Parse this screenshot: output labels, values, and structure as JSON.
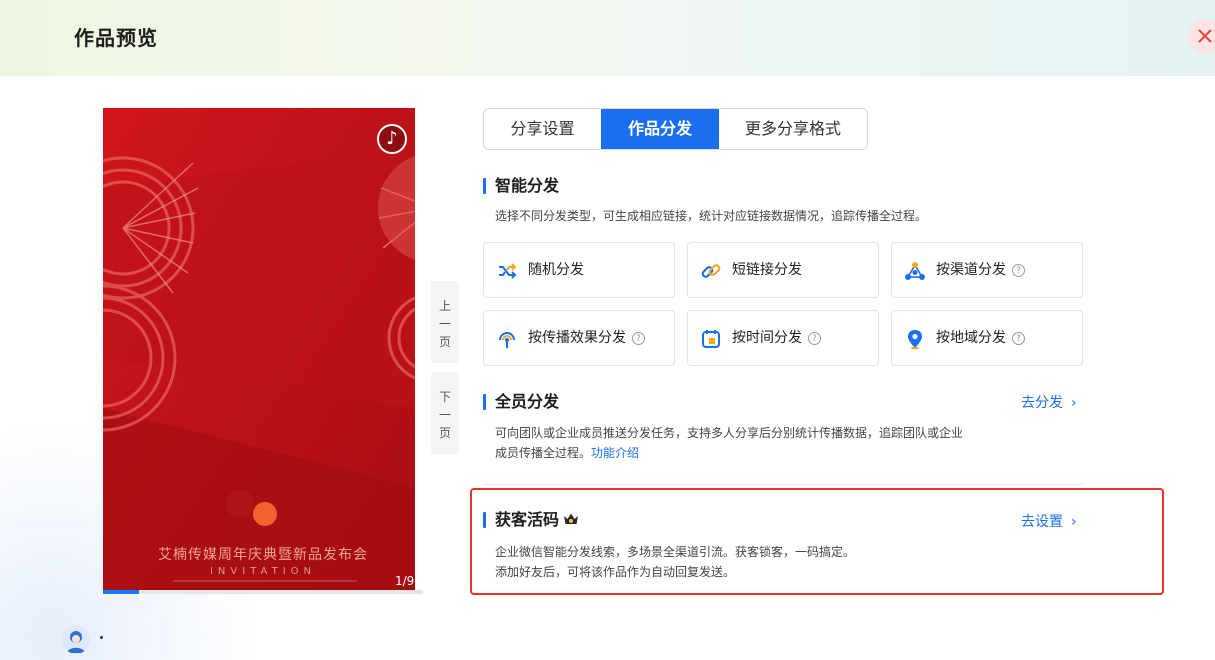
{
  "header": {
    "title": "作品预览"
  },
  "preview": {
    "event_title": "艾楠传媒周年庆典暨新品发布会",
    "invitation_text": "INVITATION",
    "page_counter": "1/9",
    "progress": 0.111
  },
  "pager": {
    "prev": [
      "上",
      "一",
      "页"
    ],
    "next": [
      "下",
      "一",
      "页"
    ]
  },
  "tabs": [
    {
      "label": "分享设置",
      "active": false
    },
    {
      "label": "作品分发",
      "active": true
    },
    {
      "label": "更多分享格式",
      "active": false
    }
  ],
  "smart": {
    "title": "智能分发",
    "desc": "选择不同分发类型，可生成相应链接，统计对应链接数据情况，追踪传播全过程。",
    "cards": [
      {
        "label": "随机分发",
        "icon": "shuffle-icon",
        "help": false
      },
      {
        "label": "短链接分发",
        "icon": "link-icon",
        "help": false
      },
      {
        "label": "按渠道分发",
        "icon": "channel-icon",
        "help": true
      },
      {
        "label": "按传播效果分发",
        "icon": "broadcast-icon",
        "help": true
      },
      {
        "label": "按时间分发",
        "icon": "calendar-icon",
        "help": true
      },
      {
        "label": "按地域分发",
        "icon": "location-pin-icon",
        "help": true
      }
    ],
    "help_glyph": "?"
  },
  "staff": {
    "title": "全员分发",
    "action": "去分发",
    "desc_line1": "可向团队或企业成员推送分发任务，支持多人分享后分别统计传播数据，追踪团队或企业",
    "desc_line2": "成员传播全过程。",
    "desc_link": "功能介绍"
  },
  "leads": {
    "title": "获客活码",
    "action": "去设置",
    "desc_line1": "企业微信智能分发线索，多场景全渠道引流。获客锁客，一码搞定。",
    "desc_line2": "添加好友后，可将该作品作为自动回复发送。"
  },
  "colors": {
    "accent": "#1a6ff0",
    "highlight": "#e8332a",
    "preview_bg": "#c7141a"
  }
}
